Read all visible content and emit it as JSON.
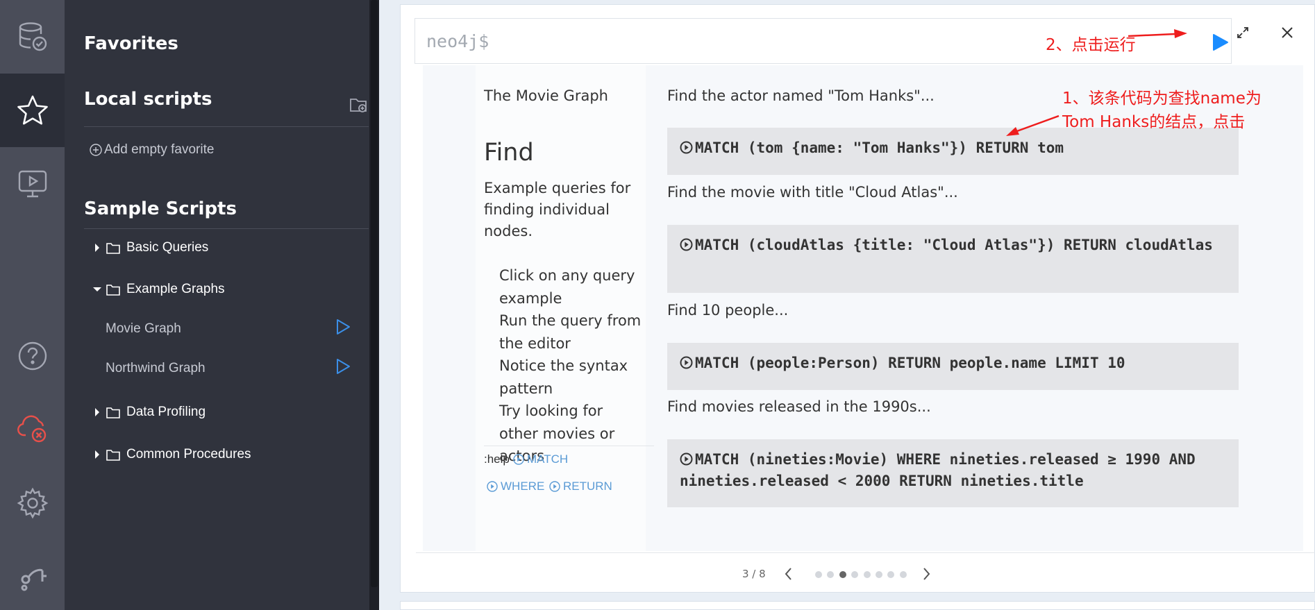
{
  "drawer": {
    "title": "Favorites",
    "local_scripts": {
      "title": "Local scripts",
      "add_empty_label": "Add empty favorite"
    },
    "sample_scripts": {
      "title": "Sample Scripts",
      "folders": [
        {
          "label": "Basic Queries",
          "expanded": false
        },
        {
          "label": "Example Graphs",
          "expanded": true,
          "items": [
            "Movie Graph",
            "Northwind Graph"
          ]
        },
        {
          "label": "Data Profiling",
          "expanded": false
        },
        {
          "label": "Common Procedures",
          "expanded": false
        }
      ]
    }
  },
  "editor": {
    "prompt": "neo4j$",
    "annotation_run": "2、点击运行"
  },
  "guide": {
    "frame_title": "The Movie Graph",
    "heading": "Find",
    "description": "Example queries for finding individual nodes.",
    "steps": [
      "Click on any query example",
      "Run the query from the editor",
      "Notice the syntax pattern",
      "Try looking for other movies or actors"
    ],
    "help_prefix": ":help",
    "help_keywords": [
      "MATCH",
      "WHERE",
      "RETURN"
    ],
    "queries": [
      {
        "description": "Find the actor named \"Tom Hanks\"...",
        "code": "MATCH (tom {name: \"Tom Hanks\"}) RETURN tom"
      },
      {
        "description": "Find the movie with title \"Cloud Atlas\"...",
        "code": "MATCH (cloudAtlas {title: \"Cloud Atlas\"}) RETURN cloudAtlas"
      },
      {
        "description": "Find 10 people...",
        "code": "MATCH (people:Person) RETURN people.name LIMIT 10"
      },
      {
        "description": "Find movies released in the 1990s...",
        "code": "MATCH (nineties:Movie) WHERE nineties.released ≥ 1990 AND nineties.released < 2000 RETURN nineties.title"
      }
    ],
    "annotation_query": [
      "1、该条代码为查找name为",
      "Tom Hanks的结点，点击"
    ],
    "pager": {
      "label": "3 / 8",
      "current": 3,
      "total": 8
    }
  },
  "colors": {
    "rail": "#4a4d59",
    "rail_active": "#2b2e38",
    "drawer": "#30333d",
    "accent": "#1a8cff",
    "annotation": "#ee1d1d",
    "error_icon": "#e8504a",
    "link": "#5b9bd5"
  },
  "icons": {
    "rail": [
      "database-icon",
      "star-icon",
      "monitor-play-icon",
      "help-icon",
      "cloud-error-icon",
      "settings-icon",
      "neo4j-logo-icon"
    ]
  }
}
